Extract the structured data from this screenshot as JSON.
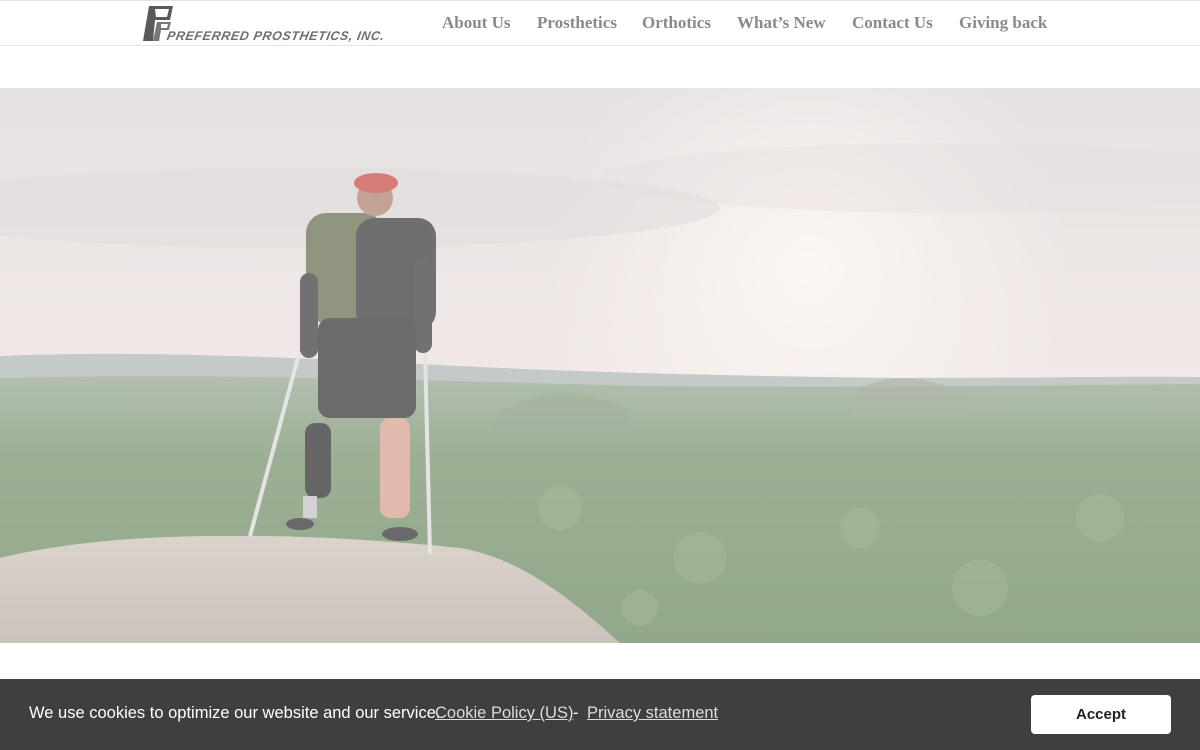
{
  "header": {
    "logo_text": "PREFERRED PROSTHETICS, INC.",
    "nav": [
      {
        "label": "About Us"
      },
      {
        "label": "Prosthetics"
      },
      {
        "label": "Orthotics"
      },
      {
        "label": "What’s New"
      },
      {
        "label": "Contact Us"
      },
      {
        "label": "Giving back"
      }
    ]
  },
  "hero": {
    "image": "hiker-with-crutches-on-cliff-overlooking-forest"
  },
  "cookie_banner": {
    "message": "We use cookies to optimize our website and our service.",
    "cookie_policy_link": "Cookie Policy (US)",
    "separator": "-",
    "privacy_link": "Privacy statement",
    "accept_label": "Accept"
  },
  "colors": {
    "nav_text": "#8a8a8a",
    "cookie_bar_bg": "#3f3f3f",
    "accept_bg": "#ffffff"
  }
}
